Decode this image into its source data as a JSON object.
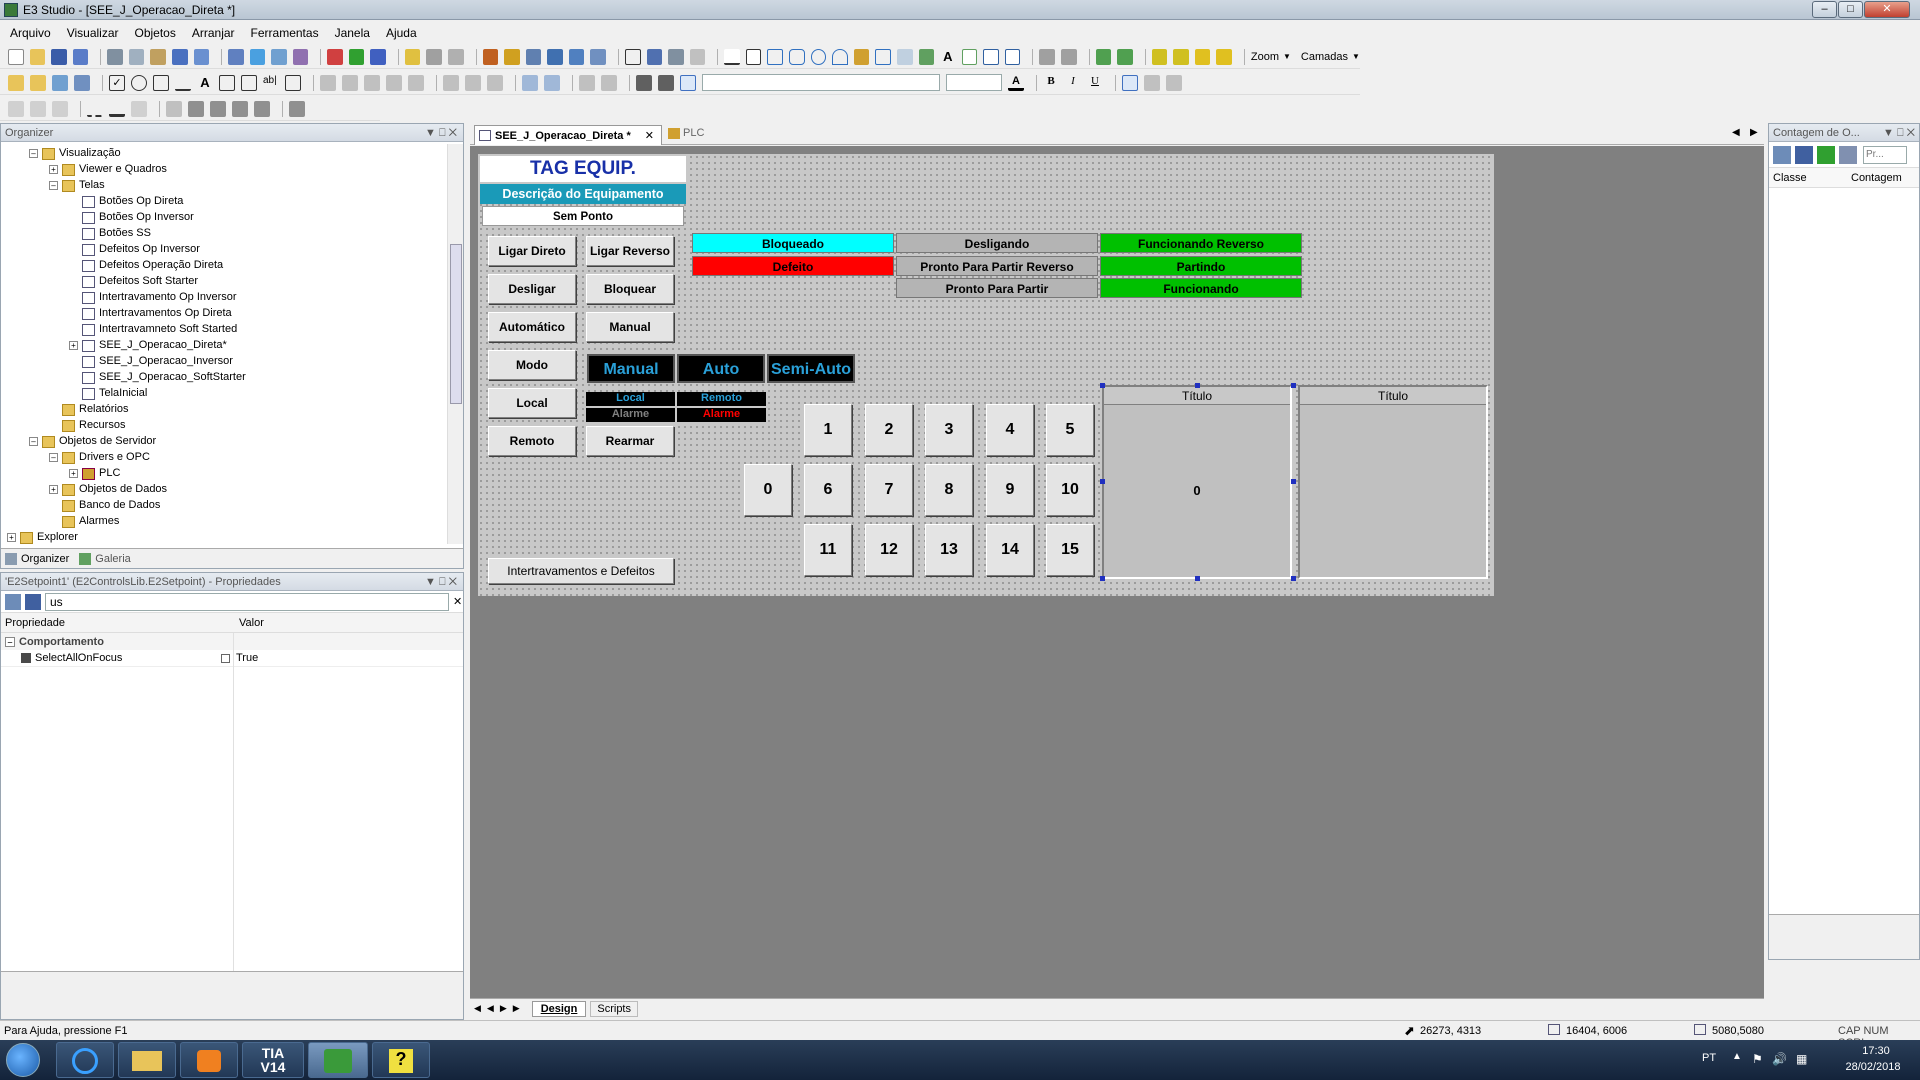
{
  "window": {
    "title": "E3 Studio - [SEE_J_Operacao_Direta *]"
  },
  "menu": [
    "Arquivo",
    "Visualizar",
    "Objetos",
    "Arranjar",
    "Ferramentas",
    "Janela",
    "Ajuda"
  ],
  "toolbar": {
    "zoom_label": "Zoom",
    "layers_label": "Camadas"
  },
  "organizer": {
    "title": "Organizer",
    "items": [
      {
        "label": "Visualização",
        "level": 1
      },
      {
        "label": "Viewer e Quadros",
        "level": 2
      },
      {
        "label": "Telas",
        "level": 2
      },
      {
        "label": "Botões Op Direta",
        "level": 3
      },
      {
        "label": "Botões Op Inversor",
        "level": 3
      },
      {
        "label": "Botões SS",
        "level": 3
      },
      {
        "label": "Defeitos Op Inversor",
        "level": 3
      },
      {
        "label": "Defeitos Operação Direta",
        "level": 3
      },
      {
        "label": "Defeitos Soft Starter",
        "level": 3
      },
      {
        "label": "Intertravamento Op Inversor",
        "level": 3
      },
      {
        "label": "Intertravamentos Op Direta",
        "level": 3
      },
      {
        "label": "Intertravamneto Soft Started",
        "level": 3
      },
      {
        "label": "SEE_J_Operacao_Direta*",
        "level": 3
      },
      {
        "label": "SEE_J_Operacao_Inversor",
        "level": 3
      },
      {
        "label": "SEE_J_Operacao_SoftStarter",
        "level": 3
      },
      {
        "label": "TelaInicial",
        "level": 3
      },
      {
        "label": "Relatórios",
        "level": 2
      },
      {
        "label": "Recursos",
        "level": 2
      },
      {
        "label": "Objetos de Servidor",
        "level": 1
      },
      {
        "label": "Drivers e OPC",
        "level": 2
      },
      {
        "label": "PLC",
        "level": 3
      },
      {
        "label": "Objetos de Dados",
        "level": 2
      },
      {
        "label": "Banco de Dados",
        "level": 2
      },
      {
        "label": "Alarmes",
        "level": 2
      },
      {
        "label": "Explorer",
        "level": 0
      }
    ],
    "tabs": [
      "Organizer",
      "Galeria"
    ]
  },
  "properties": {
    "title": "'E2Setpoint1' (E2ControlsLib.E2Setpoint) - Propriedades",
    "search_value": "us",
    "col_property": "Propriedade",
    "col_value": "Valor",
    "category": "Comportamento",
    "row_name": "SelectAllOnFocus",
    "row_value": "True"
  },
  "doc_tabs": [
    "SEE_J_Operacao_Direta *",
    "PLC"
  ],
  "canvas": {
    "tag": "TAG EQUIP.",
    "description": "Descrição do Equipamento",
    "no_point": "Sem Ponto",
    "buttons": [
      "Ligar Direto",
      "Ligar Reverso",
      "Desligar",
      "Bloquear",
      "Automático",
      "Manual",
      "Modo",
      "Local",
      "Remoto",
      "Rearmar"
    ],
    "interlock_button": "Intertravamentos e Defeitos",
    "status": [
      {
        "label": "Bloqueado",
        "color": "#00ffff"
      },
      {
        "label": "Defeito",
        "color": "#ff0000"
      },
      {
        "label": "Desligando",
        "color": "#b4b4b4"
      },
      {
        "label": "Pronto Para Partir Reverso",
        "color": "#b4b4b4"
      },
      {
        "label": "Pronto Para Partir",
        "color": "#b4b4b4"
      },
      {
        "label": "Funcionando Reverso",
        "color": "#00c000"
      },
      {
        "label": "Partindo",
        "color": "#00c000"
      },
      {
        "label": "Funcionando",
        "color": "#00c000"
      }
    ],
    "modes": [
      "Manual",
      "Auto",
      "Semi-Auto"
    ],
    "lamps": [
      {
        "label": "Local",
        "color": "#2aa0d8"
      },
      {
        "label": "Remoto",
        "color": "#2aa0d8"
      },
      {
        "label": "Alarme",
        "color": "#808080"
      },
      {
        "label": "Alarme",
        "color": "#ff0000"
      }
    ],
    "numbers": [
      "1",
      "2",
      "3",
      "4",
      "5",
      "0",
      "6",
      "7",
      "8",
      "9",
      "10",
      "11",
      "12",
      "13",
      "14",
      "15"
    ],
    "frame1_title": "Título",
    "frame1_value": "0",
    "frame2_title": "Título"
  },
  "bottom_tabs": [
    "Design",
    "Scripts"
  ],
  "count_panel": {
    "title": "Contagem de O...",
    "search_placeholder": "Pr...",
    "col_class": "Classe",
    "col_count": "Contagem"
  },
  "status": {
    "help": "Para Ajuda, pressione F1",
    "cursor": "26273, 4313",
    "position": "16404, 6006",
    "size": "5080,5080",
    "keys": "CAP  NUM  SCRL"
  },
  "taskbar": {
    "lang": "PT",
    "time": "17:30",
    "date": "28/02/2018",
    "tia": "TIA\nV14"
  }
}
